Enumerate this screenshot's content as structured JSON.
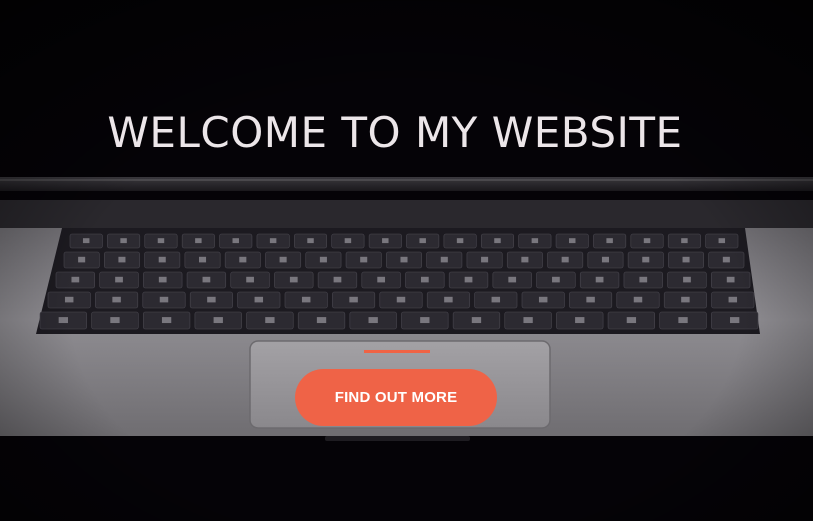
{
  "hero": {
    "title": "WELCOME TO MY WEBSITE",
    "cta_label": "FIND OUT MORE",
    "background_image": "laptop-keyboard-photo"
  },
  "colors": {
    "background": "#050307",
    "title_text": "#ece6e9",
    "accent": "#ef6347"
  }
}
